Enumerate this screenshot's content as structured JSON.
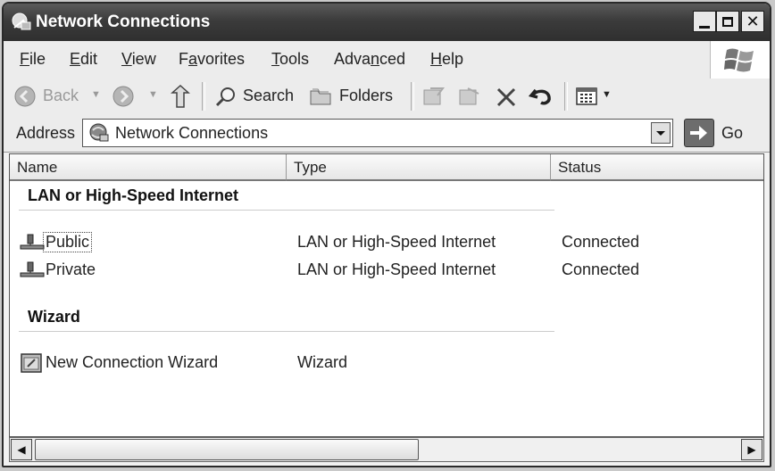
{
  "window": {
    "title": "Network Connections"
  },
  "menu": {
    "items": [
      {
        "label": "File",
        "key": "F"
      },
      {
        "label": "Edit",
        "key": "E"
      },
      {
        "label": "View",
        "key": "V"
      },
      {
        "label": "Favorites",
        "key": "a"
      },
      {
        "label": "Tools",
        "key": "T"
      },
      {
        "label": "Advanced",
        "key": "n"
      },
      {
        "label": "Help",
        "key": "H"
      }
    ]
  },
  "toolbar": {
    "back_label": "Back",
    "search_label": "Search",
    "folders_label": "Folders"
  },
  "address": {
    "label": "Address",
    "value": "Network Connections",
    "go_label": "Go"
  },
  "columns": {
    "name": "Name",
    "type": "Type",
    "status": "Status"
  },
  "groups": [
    {
      "title": "LAN or High-Speed Internet",
      "items": [
        {
          "name": "Public",
          "type": "LAN or High-Speed Internet",
          "status": "Connected",
          "icon": "network-adapter-icon"
        },
        {
          "name": "Private",
          "type": "LAN or High-Speed Internet",
          "status": "Connected",
          "icon": "network-adapter-icon"
        }
      ]
    },
    {
      "title": "Wizard",
      "items": [
        {
          "name": "New Connection Wizard",
          "type": "Wizard",
          "status": "",
          "icon": "wizard-icon"
        }
      ]
    }
  ]
}
